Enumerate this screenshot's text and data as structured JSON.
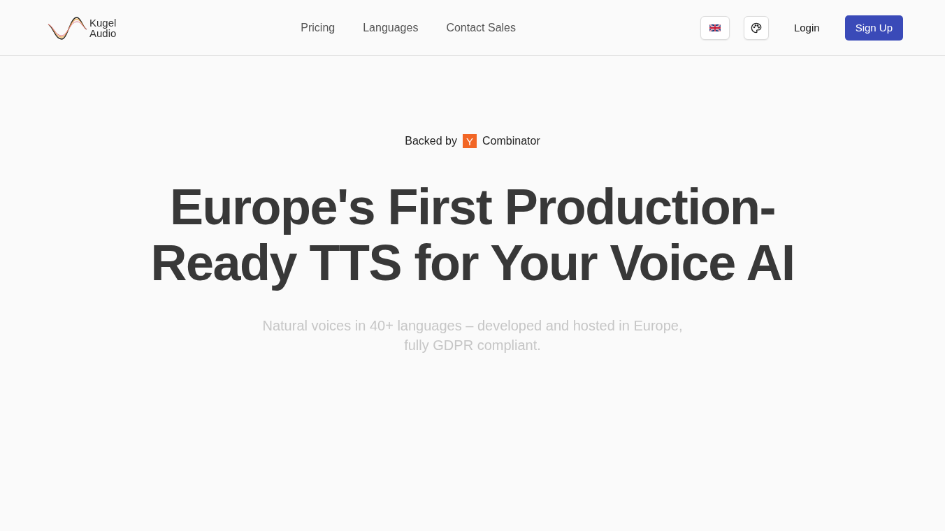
{
  "header": {
    "logo": {
      "lines": [
        "Kugel",
        "Audio"
      ]
    },
    "nav": [
      "Pricing",
      "Languages",
      "Contact Sales"
    ],
    "login": "Login",
    "signup": "Sign Up"
  },
  "hero": {
    "backed": {
      "prefix": "Backed by",
      "badge": "Y",
      "suffix": "Combinator"
    },
    "headline": "Europe's First Production-Ready TTS for Your Voice AI",
    "subtitle": "Natural voices in 40+ languages – developed and hosted in Europe, fully GDPR compliant."
  }
}
